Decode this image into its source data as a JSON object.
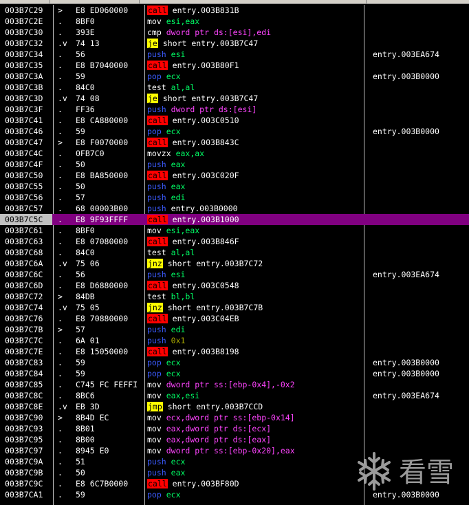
{
  "rows": [
    {
      "addr": "003B7C29",
      "mark": ">",
      "hex": "E8 ED060000",
      "mnem": "call",
      "mclass": "call",
      "ops": "entry.003B831B",
      "oclass": "lbl",
      "comment": ""
    },
    {
      "addr": "003B7C2E",
      "mark": ".",
      "hex": "8BF0",
      "mnem": "mov",
      "mclass": "plain",
      "ops": "esi,eax",
      "oclass": "reg",
      "comment": ""
    },
    {
      "addr": "003B7C30",
      "mark": ".",
      "hex": "393E",
      "mnem": "cmp",
      "mclass": "plain",
      "ops": "dword ptr ds:[esi],edi",
      "oclass": "mem",
      "comment": ""
    },
    {
      "addr": "003B7C32",
      "mark": ".v",
      "hex": "74 13",
      "mnem": "je",
      "mclass": "jcc",
      "ops": "short entry.003B7C47",
      "oclass": "lbl",
      "comment": ""
    },
    {
      "addr": "003B7C34",
      "mark": ".",
      "hex": "56",
      "mnem": "push",
      "mclass": "push",
      "ops": "esi",
      "oclass": "reg",
      "comment": "entry.003EA674"
    },
    {
      "addr": "003B7C35",
      "mark": ".",
      "hex": "E8 B7040000",
      "mnem": "call",
      "mclass": "call",
      "ops": "entry.003B80F1",
      "oclass": "lbl",
      "comment": ""
    },
    {
      "addr": "003B7C3A",
      "mark": ".",
      "hex": "59",
      "mnem": "pop",
      "mclass": "pop",
      "ops": "ecx",
      "oclass": "reg",
      "comment": "entry.003B0000"
    },
    {
      "addr": "003B7C3B",
      "mark": ".",
      "hex": "84C0",
      "mnem": "test",
      "mclass": "plain",
      "ops": "al,al",
      "oclass": "reg",
      "comment": ""
    },
    {
      "addr": "003B7C3D",
      "mark": ".v",
      "hex": "74 08",
      "mnem": "je",
      "mclass": "jcc",
      "ops": "short entry.003B7C47",
      "oclass": "lbl",
      "comment": ""
    },
    {
      "addr": "003B7C3F",
      "mark": ".",
      "hex": "FF36",
      "mnem": "push",
      "mclass": "push",
      "ops": "dword ptr ds:[esi]",
      "oclass": "mem",
      "comment": ""
    },
    {
      "addr": "003B7C41",
      "mark": ".",
      "hex": "E8 CA880000",
      "mnem": "call",
      "mclass": "call",
      "ops": "entry.003C0510",
      "oclass": "lbl",
      "comment": ""
    },
    {
      "addr": "003B7C46",
      "mark": ".",
      "hex": "59",
      "mnem": "pop",
      "mclass": "pop",
      "ops": "ecx",
      "oclass": "reg",
      "comment": "entry.003B0000"
    },
    {
      "addr": "003B7C47",
      "mark": ">",
      "hex": "E8 F0070000",
      "mnem": "call",
      "mclass": "call",
      "ops": "entry.003B843C",
      "oclass": "lbl",
      "comment": ""
    },
    {
      "addr": "003B7C4C",
      "mark": ".",
      "hex": "0FB7C0",
      "mnem": "movzx",
      "mclass": "plain",
      "ops": "eax,ax",
      "oclass": "reg",
      "comment": ""
    },
    {
      "addr": "003B7C4F",
      "mark": ".",
      "hex": "50",
      "mnem": "push",
      "mclass": "push",
      "ops": "eax",
      "oclass": "reg",
      "comment": ""
    },
    {
      "addr": "003B7C50",
      "mark": ".",
      "hex": "E8 BA850000",
      "mnem": "call",
      "mclass": "call",
      "ops": "entry.003C020F",
      "oclass": "lbl",
      "comment": ""
    },
    {
      "addr": "003B7C55",
      "mark": ".",
      "hex": "50",
      "mnem": "push",
      "mclass": "push",
      "ops": "eax",
      "oclass": "reg",
      "comment": ""
    },
    {
      "addr": "003B7C56",
      "mark": ".",
      "hex": "57",
      "mnem": "push",
      "mclass": "push",
      "ops": "edi",
      "oclass": "reg",
      "comment": ""
    },
    {
      "addr": "003B7C57",
      "mark": ".",
      "hex": "68 00003B00",
      "mnem": "push",
      "mclass": "push",
      "ops": "entry.003B0000",
      "oclass": "lbl",
      "comment": ""
    },
    {
      "addr": "003B7C5C",
      "mark": ".",
      "hex": "E8 9F93FFFF",
      "mnem": "call",
      "mclass": "call",
      "ops": "entry.003B1000",
      "oclass": "lbl",
      "comment": "",
      "selected": true
    },
    {
      "addr": "003B7C61",
      "mark": ".",
      "hex": "8BF0",
      "mnem": "mov",
      "mclass": "plain",
      "ops": "esi,eax",
      "oclass": "reg",
      "comment": ""
    },
    {
      "addr": "003B7C63",
      "mark": ".",
      "hex": "E8 07080000",
      "mnem": "call",
      "mclass": "call",
      "ops": "entry.003B846F",
      "oclass": "lbl",
      "comment": ""
    },
    {
      "addr": "003B7C68",
      "mark": ".",
      "hex": "84C0",
      "mnem": "test",
      "mclass": "plain",
      "ops": "al,al",
      "oclass": "reg",
      "comment": ""
    },
    {
      "addr": "003B7C6A",
      "mark": ".v",
      "hex": "75 06",
      "mnem": "jnz",
      "mclass": "jcc",
      "ops": "short entry.003B7C72",
      "oclass": "lbl",
      "comment": ""
    },
    {
      "addr": "003B7C6C",
      "mark": ".",
      "hex": "56",
      "mnem": "push",
      "mclass": "push",
      "ops": "esi",
      "oclass": "reg",
      "comment": "entry.003EA674"
    },
    {
      "addr": "003B7C6D",
      "mark": ".",
      "hex": "E8 D6880000",
      "mnem": "call",
      "mclass": "call",
      "ops": "entry.003C0548",
      "oclass": "lbl",
      "comment": ""
    },
    {
      "addr": "003B7C72",
      "mark": ">",
      "hex": "84DB",
      "mnem": "test",
      "mclass": "plain",
      "ops": "bl,bl",
      "oclass": "reg",
      "comment": ""
    },
    {
      "addr": "003B7C74",
      "mark": ".v",
      "hex": "75 05",
      "mnem": "jnz",
      "mclass": "jcc",
      "ops": "short entry.003B7C7B",
      "oclass": "lbl",
      "comment": ""
    },
    {
      "addr": "003B7C76",
      "mark": ".",
      "hex": "E8 70880000",
      "mnem": "call",
      "mclass": "call",
      "ops": "entry.003C04EB",
      "oclass": "lbl",
      "comment": ""
    },
    {
      "addr": "003B7C7B",
      "mark": ">",
      "hex": "57",
      "mnem": "push",
      "mclass": "push",
      "ops": "edi",
      "oclass": "reg",
      "comment": ""
    },
    {
      "addr": "003B7C7C",
      "mark": ".",
      "hex": "6A 01",
      "mnem": "push",
      "mclass": "push",
      "ops": "0x1",
      "oclass": "imm",
      "comment": ""
    },
    {
      "addr": "003B7C7E",
      "mark": ".",
      "hex": "E8 15050000",
      "mnem": "call",
      "mclass": "call",
      "ops": "entry.003B8198",
      "oclass": "lbl",
      "comment": ""
    },
    {
      "addr": "003B7C83",
      "mark": ".",
      "hex": "59",
      "mnem": "pop",
      "mclass": "pop",
      "ops": "ecx",
      "oclass": "reg",
      "comment": "entry.003B0000"
    },
    {
      "addr": "003B7C84",
      "mark": ".",
      "hex": "59",
      "mnem": "pop",
      "mclass": "pop",
      "ops": "ecx",
      "oclass": "reg",
      "comment": "entry.003B0000"
    },
    {
      "addr": "003B7C85",
      "mark": ".",
      "hex": "C745 FC FEFFI",
      "mnem": "mov",
      "mclass": "plain",
      "ops": "dword ptr ss:[ebp-0x4],-0x2",
      "oclass": "mem",
      "comment": ""
    },
    {
      "addr": "003B7C8C",
      "mark": ".",
      "hex": "8BC6",
      "mnem": "mov",
      "mclass": "plain",
      "ops": "eax,esi",
      "oclass": "reg",
      "comment": "entry.003EA674"
    },
    {
      "addr": "003B7C8E",
      "mark": ".v",
      "hex": "EB 3D",
      "mnem": "jmp",
      "mclass": "jcc",
      "ops": "short entry.003B7CCD",
      "oclass": "lbl",
      "comment": ""
    },
    {
      "addr": "003B7C90",
      "mark": ">",
      "hex": "8B4D EC",
      "mnem": "mov",
      "mclass": "plain",
      "ops": "ecx,dword ptr ss:[ebp-0x14]",
      "oclass": "mem",
      "comment": ""
    },
    {
      "addr": "003B7C93",
      "mark": ".",
      "hex": "8B01",
      "mnem": "mov",
      "mclass": "plain",
      "ops": "eax,dword ptr ds:[ecx]",
      "oclass": "mem",
      "comment": ""
    },
    {
      "addr": "003B7C95",
      "mark": ".",
      "hex": "8B00",
      "mnem": "mov",
      "mclass": "plain",
      "ops": "eax,dword ptr ds:[eax]",
      "oclass": "mem",
      "comment": ""
    },
    {
      "addr": "003B7C97",
      "mark": ".",
      "hex": "8945 E0",
      "mnem": "mov",
      "mclass": "plain",
      "ops": "dword ptr ss:[ebp-0x20],eax",
      "oclass": "mem",
      "comment": ""
    },
    {
      "addr": "003B7C9A",
      "mark": ".",
      "hex": "51",
      "mnem": "push",
      "mclass": "push",
      "ops": "ecx",
      "oclass": "reg",
      "comment": ""
    },
    {
      "addr": "003B7C9B",
      "mark": ".",
      "hex": "50",
      "mnem": "push",
      "mclass": "push",
      "ops": "eax",
      "oclass": "reg",
      "comment": ""
    },
    {
      "addr": "003B7C9C",
      "mark": ".",
      "hex": "E8 6C7B0000",
      "mnem": "call",
      "mclass": "call",
      "ops": "entry.003BF80D",
      "oclass": "lbl",
      "comment": ""
    },
    {
      "addr": "003B7CA1",
      "mark": ".",
      "hex": "59",
      "mnem": "pop",
      "mclass": "pop",
      "ops": "ecx",
      "oclass": "reg",
      "comment": "entry.003B0000"
    }
  ],
  "watermark": {
    "text": "看雪",
    "icon": "snowflake-icon"
  },
  "colors": {
    "call": "#ff0000",
    "jcc": "#ffff00",
    "push_pop": "#3b5bff",
    "register": "#00ff66",
    "memory": "#ff44ff",
    "selection": "#800080",
    "background": "#000000"
  }
}
